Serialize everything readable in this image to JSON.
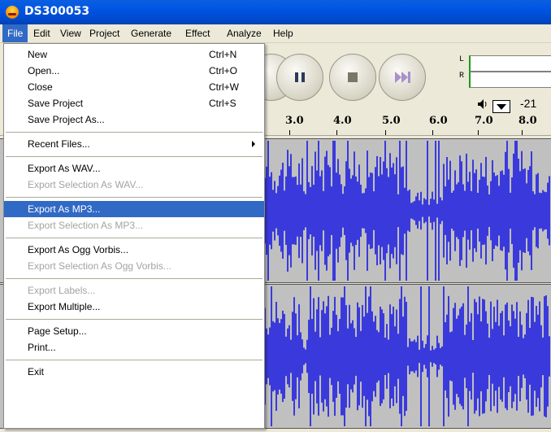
{
  "window": {
    "title": "DS300053"
  },
  "menubar": [
    "File",
    "Edit",
    "View",
    "Project",
    "Generate",
    "Effect",
    "Analyze",
    "Help"
  ],
  "file_menu": {
    "items": [
      {
        "label": "New",
        "shortcut": "Ctrl+N"
      },
      {
        "label": "Open...",
        "shortcut": "Ctrl+O"
      },
      {
        "label": "Close",
        "shortcut": "Ctrl+W"
      },
      {
        "label": "Save Project",
        "shortcut": "Ctrl+S"
      },
      {
        "label": "Save Project As..."
      },
      {
        "label": "Recent Files...",
        "submenu": true
      },
      {
        "label": "Export As WAV..."
      },
      {
        "label": "Export Selection As WAV...",
        "disabled": true
      },
      {
        "label": "Export As MP3...",
        "highlighted": true
      },
      {
        "label": "Export Selection As MP3...",
        "disabled": true
      },
      {
        "label": "Export As Ogg Vorbis..."
      },
      {
        "label": "Export Selection As Ogg Vorbis...",
        "disabled": true
      },
      {
        "label": "Export Labels...",
        "disabled": true
      },
      {
        "label": "Export Multiple..."
      },
      {
        "label": "Page Setup..."
      },
      {
        "label": "Print..."
      },
      {
        "label": "Exit"
      }
    ]
  },
  "meter": {
    "left": "L",
    "right": "R",
    "value": "-21",
    "icons": [
      "speaker-icon",
      "dropdown-arrow-icon"
    ]
  },
  "ruler": {
    "labels": [
      "3.0",
      "4.0",
      "5.0",
      "6.0",
      "7.0",
      "8.0"
    ]
  },
  "transport": {
    "icons": [
      "pause-icon",
      "stop-icon",
      "skip-to-end-icon"
    ]
  },
  "colors": {
    "waveform": "#3a3adc",
    "track_bg": "#c0c0c0",
    "selection": "#316ac5",
    "titlebar": "#0054e3"
  }
}
